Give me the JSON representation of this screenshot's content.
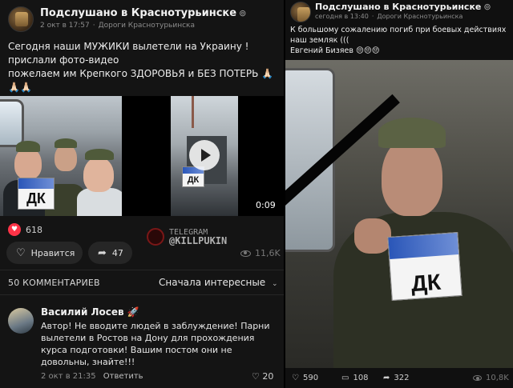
{
  "left_post": {
    "channel": "Подслушано в Краснотурьинске",
    "date": "2 окт в 17:57",
    "sep": "·",
    "category": "Дороги Краснотурьинска",
    "text": {
      "line1": "Сегодня наши МУЖИКИ вылетели на Украину !",
      "line2": "прислали фото-видео",
      "line3": "пожелаем им Крепкого ЗДОРОВЬЯ и БЕЗ ПОТЕРЬ 🙏🏻",
      "line4": "🙏🏻🙏🏻"
    },
    "sign_text": "ДК",
    "video_duration": "0:09",
    "reactions_count": "618",
    "like_label": "Нравится",
    "shares": "47",
    "views": "11,6K"
  },
  "watermark": {
    "line1": "TELEGRAM",
    "line2": "@KILLPUKIN"
  },
  "comments": {
    "header": "50 КОММЕНТАРИЕВ",
    "sort_label": "Сначала интересные",
    "items": [
      {
        "author": "Василий Лосев 🚀",
        "lines": [
          "Автор! Не вводите людей в заблуждение! Парни",
          "вылетели в Ростов на Дону для прохождения",
          "курса подготовки! Вашим постом они не",
          "довольны, знайте!!!"
        ],
        "date": "2 окт в 21:35",
        "reply_label": "Ответить",
        "likes": "20"
      }
    ]
  },
  "right_post": {
    "channel": "Подслушано в Краснотурьинске",
    "date": "сегодня в 13:40",
    "sep": "·",
    "category": "Дороги Краснотурьинска",
    "text": {
      "line1": "К большому сожалению погиб при боевых действиях",
      "line2": "наш земляк (((",
      "line3": "Евгений Бизяев 😔😔😔"
    },
    "sign_text": "ДК",
    "likes": "590",
    "comments": "108",
    "shares": "322",
    "views": "10,8K"
  },
  "icons": {
    "verified": "verified-icon",
    "heart": "heart-icon",
    "share": "share-icon",
    "comment": "comment-icon",
    "eye": "eye-icon",
    "play": "play-icon"
  },
  "colors": {
    "heart_red": "#ff3347",
    "bg": "#141414"
  }
}
